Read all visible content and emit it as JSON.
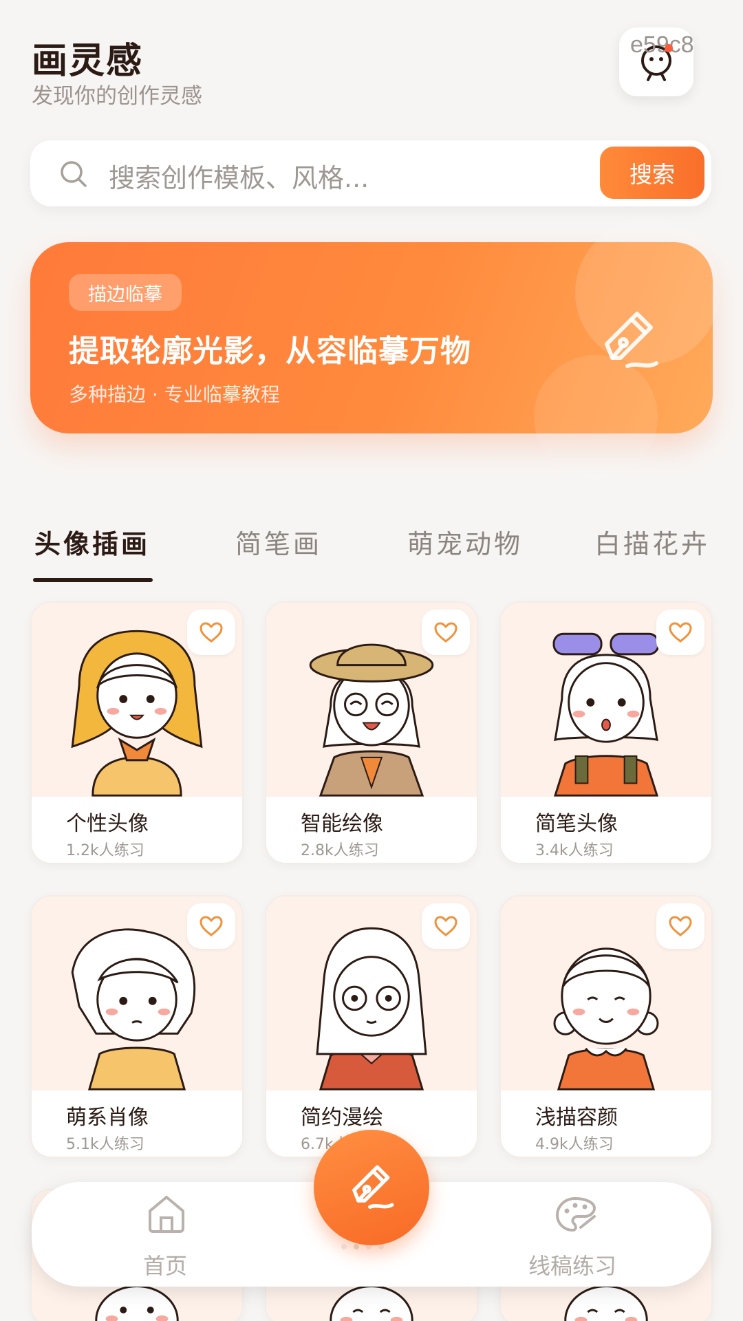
{
  "header": {
    "title": "画灵感",
    "subtitle": "发现你的创作灵感",
    "avatar_code": "e59c8"
  },
  "search": {
    "placeholder": "搜索创作模板、风格...",
    "button_label": "搜索"
  },
  "banner": {
    "tag": "描边临摹",
    "headline": "提取轮廓光影，从容临摹万物",
    "subline": "多种描边 · 专业临摹教程"
  },
  "tabs": [
    {
      "label": "头像插画",
      "active": true
    },
    {
      "label": "简笔画",
      "active": false
    },
    {
      "label": "萌宠动物",
      "active": false
    },
    {
      "label": "白描花卉",
      "active": false
    }
  ],
  "cards": [
    {
      "name": "个性头像",
      "count": "1.2k人练习"
    },
    {
      "name": "智能绘像",
      "count": "2.8k人练习"
    },
    {
      "name": "简笔头像",
      "count": "3.4k人练习"
    },
    {
      "name": "萌系肖像",
      "count": "5.1k人练习"
    },
    {
      "name": "简约漫绘",
      "count": "6.7k人练习"
    },
    {
      "name": "浅描容颜",
      "count": "4.9k人练习"
    }
  ],
  "bottom_nav": {
    "home_label": "首页",
    "practice_label": "线稿练习"
  },
  "colors": {
    "accent": "#f97a30",
    "background": "#f7f5f3",
    "text_primary": "#2b1b14",
    "text_muted": "#9e9893"
  },
  "icons": {
    "search": "search-icon",
    "favorite": "heart-icon",
    "banner": "pen-nib-icon",
    "home": "home-icon",
    "practice": "palette-icon",
    "create": "pen-nib-icon"
  }
}
